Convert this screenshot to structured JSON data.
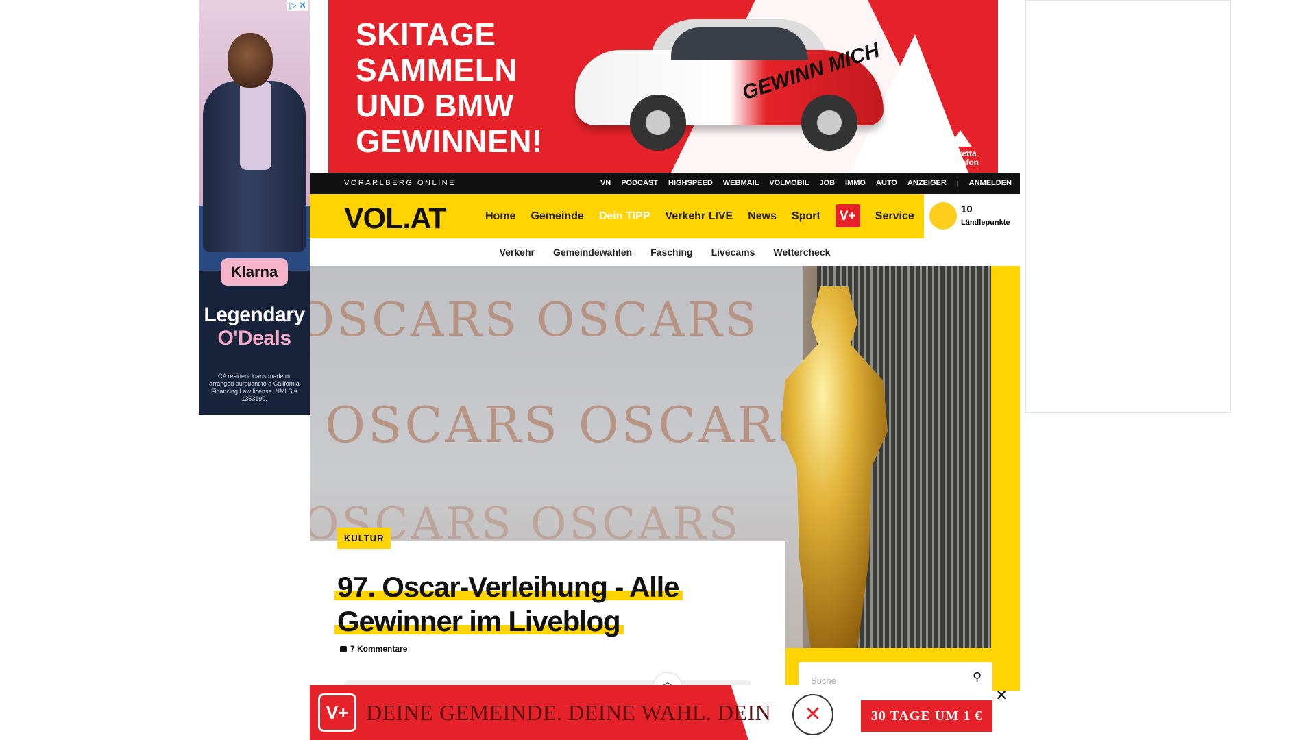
{
  "left_ad": {
    "adchoices": "▷ ✕",
    "brand": "Klarna",
    "headline1": "Legendary",
    "headline2": "O'Deals",
    "disclaimer": "CA resident loans made or arranged pursuant to a California Financing Law license. NMLS # 1353190."
  },
  "top_ad": {
    "lines": [
      "SKITAGE",
      "SAMMELN",
      "UND BMW",
      "GEWINNEN!"
    ],
    "car_text": "GEWINN MICH",
    "sponsor": "Silvretta\nMontafon",
    "accent": "#e52229"
  },
  "site": {
    "brand_tagline": "VORARLBERG ONLINE",
    "top_links": [
      "VN",
      "PODCAST",
      "HIGHSPEED",
      "WEBMAIL",
      "VOLMOBIL",
      "JOB",
      "IMMO",
      "AUTO",
      "ANZEIGER",
      "|",
      "ANMELDEN"
    ],
    "logo": "VOL.AT",
    "nav": [
      "Home",
      "Gemeinde",
      "Dein TIPP",
      "Verkehr LIVE",
      "News",
      "Sport"
    ],
    "vplus": "V+",
    "service": "Service",
    "points_count": "10",
    "points_label": "Ländlepunkte",
    "subnav": [
      "Verkehr",
      "Gemeindewahlen",
      "Fasching",
      "Livecams",
      "Wettercheck"
    ],
    "brand_yellow": "#ffd400"
  },
  "hero": {
    "watermark": "OSCARS OSCARS"
  },
  "article": {
    "category": "KULTUR",
    "title_line1": "97. Oscar-Verleihung - Alle",
    "title_line2": "Gewinner im Liveblog",
    "comments": "7 Kommentare"
  },
  "search": {
    "placeholder": "Suche"
  },
  "bottom_ad": {
    "badge": "V+",
    "slogan": "DEINE GEMEINDE. DEINE WAHL. DEIN",
    "vote_mark": "✕",
    "cta": "30 TAGE UM 1 €",
    "close": "✕"
  }
}
